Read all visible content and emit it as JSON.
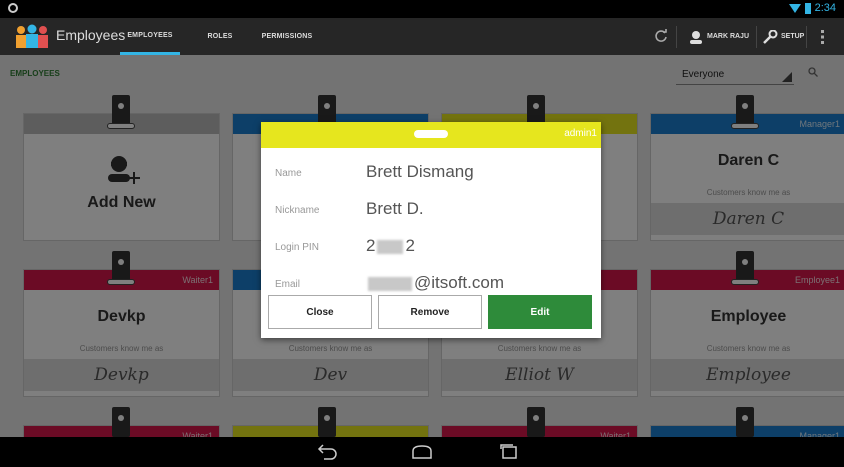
{
  "app": {
    "title": "Employees",
    "tabs": [
      {
        "label": "EMPLOYEES",
        "active": true
      },
      {
        "label": "ROLES",
        "active": false
      },
      {
        "label": "PERMISSIONS",
        "active": false
      }
    ],
    "user_label": "MARK RAJU",
    "setup_label": "SETUP"
  },
  "status": {
    "time": "2:34"
  },
  "main": {
    "section_title": "EMPLOYEES",
    "filter_value": "Everyone"
  },
  "add_new_label": "Add New",
  "known_as_label": "Customers know me as",
  "cards": [
    {
      "role": "Manager1",
      "name": "Daren C",
      "nickname": "Daren C",
      "color": "#1a7fd1"
    },
    {
      "role": "Waiter1",
      "name": "Devkp",
      "nickname": "Devkp",
      "color": "#d6174a"
    },
    {
      "role": "",
      "name": "",
      "nickname": "Dev",
      "color": "#1a7fd1"
    },
    {
      "role": "",
      "name": "",
      "nickname": "Elliot W",
      "color": "#d6174a"
    },
    {
      "role": "Employee1",
      "name": "Employee",
      "nickname": "Employee",
      "color": "#d6174a"
    },
    {
      "role": "Waiter1",
      "color": "#d6174a"
    },
    {
      "role": "",
      "color": "#e6e61e"
    },
    {
      "role": "Waiter1",
      "color": "#d6174a"
    },
    {
      "role": "Manager1",
      "color": "#1a7fd1"
    }
  ],
  "dialog": {
    "role": "admin1",
    "header_color": "#e6e61e",
    "fields": [
      {
        "label": "Name",
        "value": "Brett Dismang"
      },
      {
        "label": "Nickname",
        "value": "Brett D."
      },
      {
        "label": "Login PIN",
        "value_prefix": "2",
        "value_suffix": "2"
      },
      {
        "label": "Email",
        "value_suffix": "@itsoft.com"
      }
    ],
    "buttons": {
      "close": "Close",
      "remove": "Remove",
      "edit": "Edit"
    }
  },
  "colors": {
    "accent": "#33b5e5",
    "primary_button": "#2e8b3a",
    "manager": "#1a7fd1",
    "waiter": "#d6174a",
    "admin": "#e6e61e"
  }
}
